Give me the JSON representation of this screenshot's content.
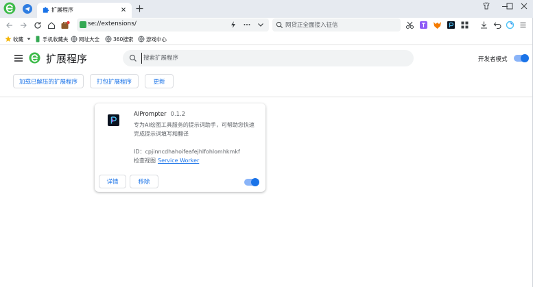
{
  "browser": {
    "tab": {
      "title": "扩展程序"
    },
    "address": {
      "url": "se://extensions/"
    },
    "search": {
      "placeholder": "网贷正全面接入征信"
    },
    "bookmarks": [
      {
        "label": "收藏",
        "icon": "star-icon"
      },
      {
        "label": "手机收藏夹",
        "icon": "phone-icon"
      },
      {
        "label": "网址大全",
        "icon": "globe-icon"
      },
      {
        "label": "360搜索",
        "icon": "globe-icon"
      },
      {
        "label": "游戏中心",
        "icon": "globe-icon"
      }
    ]
  },
  "page": {
    "title": "扩展程序",
    "search_placeholder": "搜索扩展程序",
    "developer_mode": {
      "label": "开发者模式",
      "enabled": true
    },
    "actions": {
      "load_unpacked": "加载已解压的扩展程序",
      "pack": "打包扩展程序",
      "update": "更新"
    }
  },
  "extension": {
    "name": "AIPrompter",
    "version": "0.1.2",
    "description": "专为AI绘图工具服务的提示词助手，可帮助您快速完成提示词填写和翻译",
    "id_label": "ID：",
    "id": "cpjinncdhahoifeafejhlfohlomhkmkf",
    "inspect_label": "检查视图",
    "inspect_link": "Service Worker",
    "details_label": "详情",
    "remove_label": "移除",
    "enabled": true
  },
  "colors": {
    "accent": "#1a73e8",
    "tabbar_bg": "#e6eaf0",
    "logo_green": "#3dbb4a",
    "toggle_track": "#8ab4f8"
  }
}
